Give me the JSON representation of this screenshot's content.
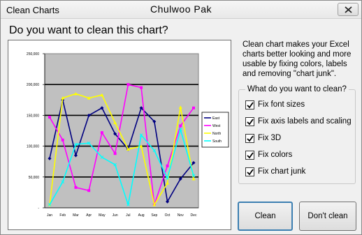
{
  "window": {
    "title": "Clean Charts",
    "center_title": "Chulwoo Pak"
  },
  "question": "Do you want to clean this chart?",
  "description": "Clean chart makes your Excel charts better looking and more usable by fixing colors, labels and removing \"chart junk\".",
  "options_group": {
    "legend": "What do you want to clean?",
    "options": [
      {
        "label": "Fix font sizes",
        "checked": true
      },
      {
        "label": "Fix axis labels and scaling",
        "checked": true
      },
      {
        "label": "Fix 3D",
        "checked": true
      },
      {
        "label": "Fix colors",
        "checked": true
      },
      {
        "label": "Fix chart junk",
        "checked": true
      }
    ]
  },
  "buttons": {
    "clean": "Clean",
    "dont_clean": "Don't clean"
  },
  "colors": {
    "plot_background": "#c0c0c0",
    "focus_border": "#3c7fb1"
  },
  "chart_data": {
    "type": "line",
    "categories": [
      "Jan",
      "Feb",
      "Mar",
      "Apr",
      "May",
      "Jun",
      "Jul",
      "Aug",
      "Sep",
      "Oct",
      "Nov",
      "Dec"
    ],
    "ylim": [
      0,
      250000
    ],
    "yticks": [
      "-",
      "50,000",
      "100,000",
      "150,000",
      "200,000",
      "250,000"
    ],
    "grid": true,
    "legend_position": "right",
    "series": [
      {
        "name": "East",
        "color": "#000080",
        "values": [
          80000,
          175000,
          85000,
          150000,
          162000,
          120000,
          95000,
          162000,
          140000,
          10000,
          47000,
          73000
        ]
      },
      {
        "name": "West",
        "color": "#ff00ff",
        "values": [
          147000,
          110000,
          33000,
          28000,
          122000,
          88000,
          200000,
          195000,
          5000,
          68000,
          133000,
          162000
        ]
      },
      {
        "name": "North",
        "color": "#ffff00",
        "values": [
          5000,
          178000,
          185000,
          178000,
          183000,
          138000,
          95000,
          100000,
          5000,
          40000,
          163000,
          47000
        ]
      },
      {
        "name": "South",
        "color": "#00ffff",
        "values": [
          5000,
          42000,
          103000,
          105000,
          82000,
          70000,
          5000,
          118000,
          93000,
          48000,
          127000,
          52000
        ]
      }
    ]
  }
}
